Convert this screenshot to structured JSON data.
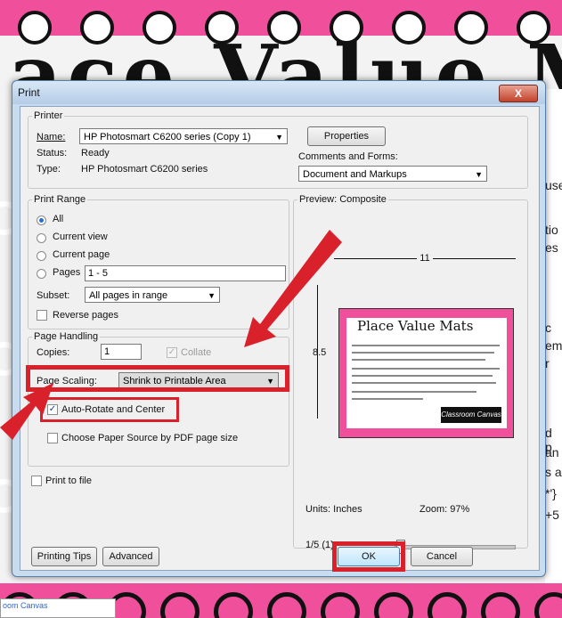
{
  "background": {
    "title_fragment": "ace Value M",
    "right_fragments": [
      "use",
      "tio",
      "es",
      "c",
      "em",
      "r",
      "d p",
      "an",
      "s a",
      "*'}",
      "+5"
    ],
    "bottom_label": "oom Canvas"
  },
  "dialog": {
    "title": "Print",
    "close_label": "X",
    "printer": {
      "legend": "Printer",
      "name_label": "Name:",
      "name_value": "HP Photosmart C6200 series (Copy 1)",
      "status_label": "Status:",
      "status_value": "Ready",
      "type_label": "Type:",
      "type_value": "HP Photosmart C6200 series",
      "properties_label": "Properties",
      "comments_label": "Comments and Forms:",
      "comments_value": "Document and Markups"
    },
    "range": {
      "legend": "Print Range",
      "options": [
        "All",
        "Current view",
        "Current page",
        "Pages"
      ],
      "selected": "All",
      "pages_value": "1 - 5",
      "subset_label": "Subset:",
      "subset_value": "All pages in range",
      "reverse_label": "Reverse pages"
    },
    "handling": {
      "legend": "Page Handling",
      "copies_label": "Copies:",
      "copies_value": "1",
      "collate_label": "Collate",
      "scaling_label": "Page Scaling:",
      "scaling_value": "Shrink to Printable Area",
      "autorotate_label": "Auto-Rotate and Center",
      "autorotate_checked": true,
      "paper_source_label": "Choose Paper Source by PDF page size"
    },
    "print_to_file_label": "Print to file",
    "preview": {
      "legend": "Preview: Composite",
      "width_label": "11",
      "height_label": "8.5",
      "thumb_title": "Place Value Mats",
      "thumb_brand": "Classroom Canvas",
      "units": "Units: Inches",
      "zoom": "Zoom:  97%",
      "page_indicator": "1/5 (1)"
    },
    "buttons": {
      "printing_tips": "Printing Tips",
      "advanced": "Advanced",
      "ok": "OK",
      "cancel": "Cancel"
    },
    "accent_red": "#d9212b"
  }
}
